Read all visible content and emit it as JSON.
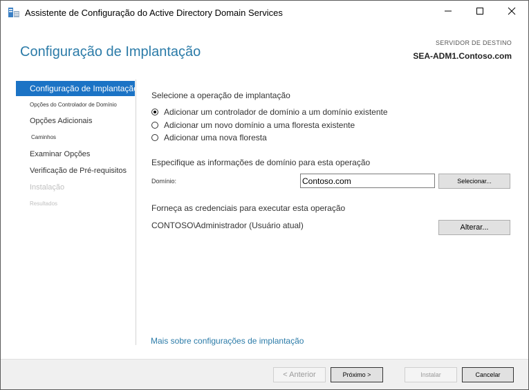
{
  "window": {
    "title": "Assistente de Configuração do Active Directory Domain Services"
  },
  "header": {
    "page_title": "Configuração de Implantação",
    "server_label": "SERVIDOR DE DESTINO",
    "server_name": "SEA-ADM1.Contoso.com"
  },
  "nav": {
    "items": [
      {
        "label": "Configuração de Implantação",
        "state": "active"
      },
      {
        "label": "Opções do Controlador de Domínio",
        "state": "enabled"
      },
      {
        "label": "Opções Adicionais",
        "state": "enabled"
      },
      {
        "label": "Caminhos",
        "state": "enabled"
      },
      {
        "label": "Examinar Opções",
        "state": "enabled"
      },
      {
        "label": "Verificação de Pré-requisitos",
        "state": "enabled"
      },
      {
        "label": "Instalação",
        "state": "disabled"
      },
      {
        "label": "Resultados",
        "state": "disabled"
      }
    ]
  },
  "main": {
    "operation_heading": "Selecione a operação de implantação",
    "options": [
      {
        "label": "Adicionar um controlador de domínio a um domínio existente",
        "selected": true
      },
      {
        "label": "Adicionar um novo domínio a uma floresta existente",
        "selected": false
      },
      {
        "label": "Adicionar uma nova floresta",
        "selected": false
      }
    ],
    "domain_heading": "Especifique as informações de domínio para esta operação",
    "domain_label": "Domínio:",
    "domain_value": "Contoso.com",
    "select_button": "Selecionar...",
    "credentials_heading": "Forneça as credenciais para executar esta operação",
    "credentials_value": "CONTOSO\\Administrador (Usuário atual)",
    "change_button": "Alterar...",
    "more_link": "Mais sobre configurações de implantação"
  },
  "footer": {
    "previous": "< Anterior",
    "next": "Próximo >",
    "install": "Instalar",
    "cancel": "Cancelar"
  },
  "colors": {
    "accent": "#2b7ba8",
    "nav_active": "#1b73c5"
  },
  "icons": [
    "app-server-icon",
    "minimize-icon",
    "maximize-icon",
    "close-icon"
  ]
}
